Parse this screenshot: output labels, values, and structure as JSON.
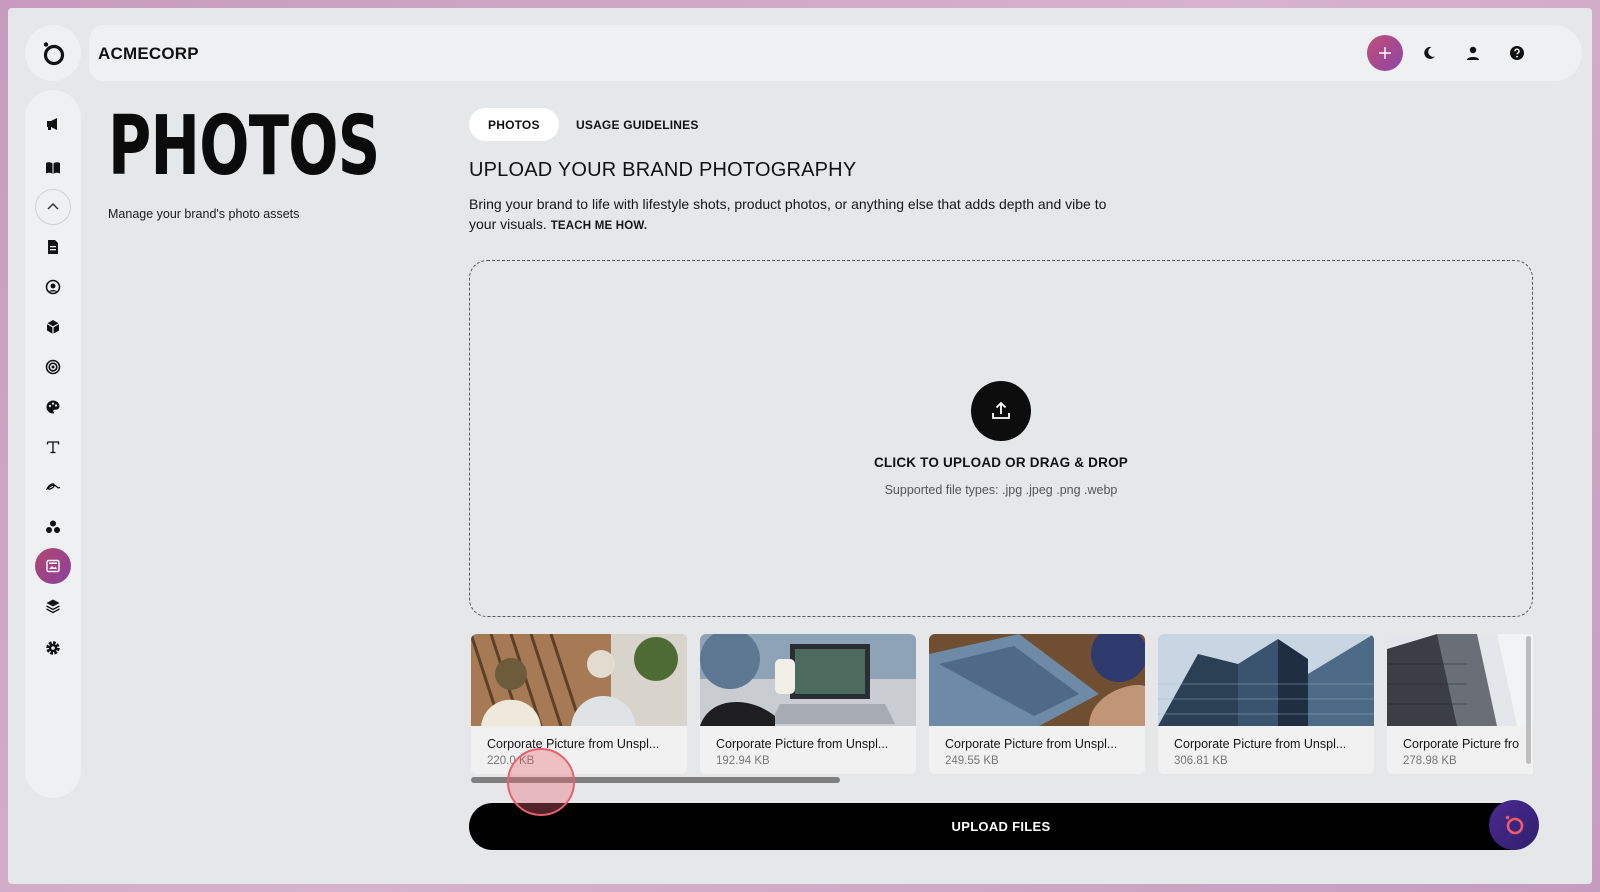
{
  "app": {
    "brand": "ACMECORP"
  },
  "colors": {
    "accent_start": "#b2486e",
    "accent_end": "#8a3f9f",
    "assistant": "#3b2482"
  },
  "rail": {
    "items": [
      {
        "name": "megaphone-icon"
      },
      {
        "name": "book-icon"
      },
      {
        "name": "chevron-up-icon"
      },
      {
        "name": "document-icon"
      },
      {
        "name": "user-circle-icon"
      },
      {
        "name": "cube-icon"
      },
      {
        "name": "target-icon"
      },
      {
        "name": "palette-icon"
      },
      {
        "name": "typography-icon"
      },
      {
        "name": "signature-icon"
      },
      {
        "name": "shapes-icon"
      },
      {
        "name": "photo-icon",
        "active": true
      },
      {
        "name": "layers-icon"
      },
      {
        "name": "settings-icon"
      }
    ]
  },
  "header": {
    "buttons": [
      "plus-icon",
      "moon-icon",
      "user-icon",
      "help-icon"
    ]
  },
  "page": {
    "title": "PHOTOS",
    "subtitle": "Manage your brand's photo assets"
  },
  "tabs": [
    {
      "label": "PHOTOS",
      "active": true
    },
    {
      "label": "USAGE GUIDELINES",
      "active": false
    }
  ],
  "section": {
    "title": "UPLOAD YOUR BRAND PHOTOGRAPHY",
    "description": "Bring your brand to life with lifestyle shots, product photos, or anything else that adds depth and vibe to your visuals.",
    "teach_link": "TEACH ME HOW."
  },
  "dropzone": {
    "title": "CLICK TO UPLOAD OR DRAG & DROP",
    "subtitle": "Supported file types: .jpg .jpeg .png .webp"
  },
  "photos": [
    {
      "name": "Corporate Picture from Unspl...",
      "size": "220.0 KB"
    },
    {
      "name": "Corporate Picture from Unspl...",
      "size": "192.94 KB"
    },
    {
      "name": "Corporate Picture from Unspl...",
      "size": "249.55 KB"
    },
    {
      "name": "Corporate Picture from Unspl...",
      "size": "306.81 KB"
    },
    {
      "name": "Corporate Picture fro",
      "size": "278.98 KB"
    }
  ],
  "actions": {
    "upload_files": "UPLOAD FILES"
  }
}
